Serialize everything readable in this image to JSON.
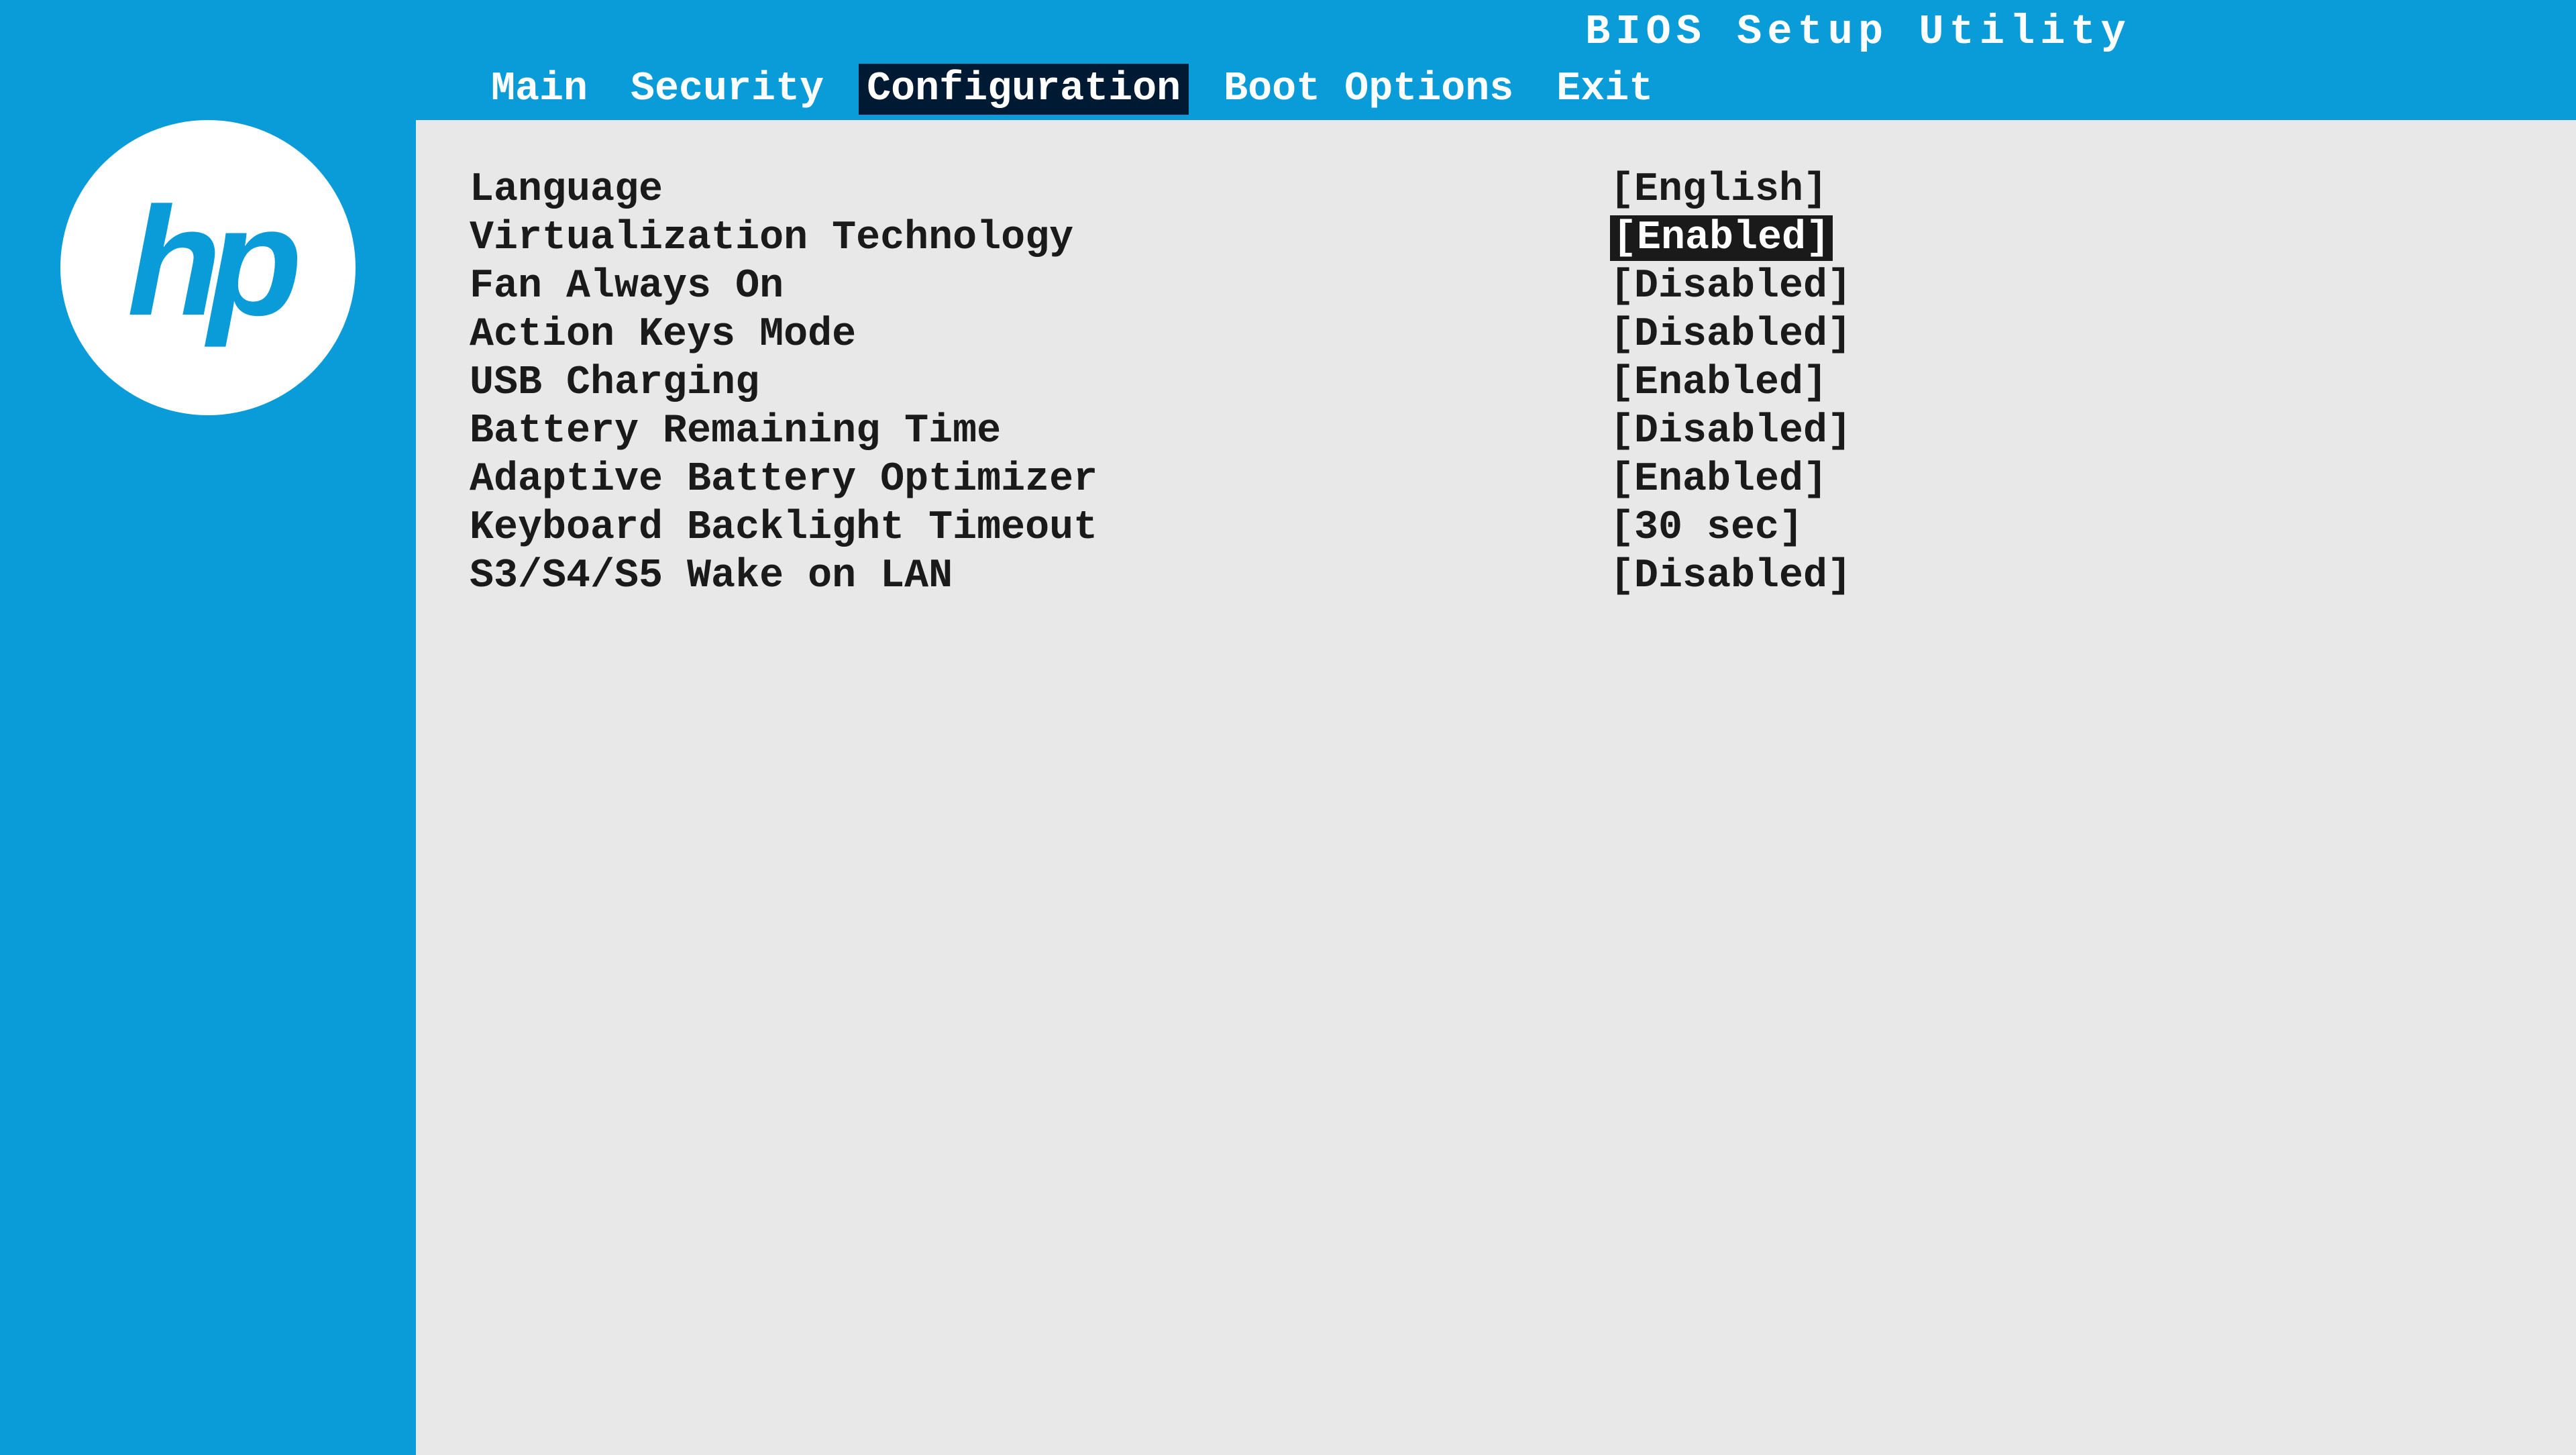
{
  "header": {
    "title": "BIOS Setup Utility",
    "tabs": [
      {
        "label": "Main",
        "active": false
      },
      {
        "label": "Security",
        "active": false
      },
      {
        "label": "Configuration",
        "active": true
      },
      {
        "label": "Boot Options",
        "active": false
      },
      {
        "label": "Exit",
        "active": false
      }
    ]
  },
  "logo": "hp",
  "settings": [
    {
      "label": "Language",
      "value": "[English]",
      "selected": false
    },
    {
      "label": "Virtualization Technology",
      "value": "[Enabled]",
      "selected": true
    },
    {
      "label": "Fan Always On",
      "value": "[Disabled]",
      "selected": false
    },
    {
      "label": "Action Keys Mode",
      "value": "[Disabled]",
      "selected": false
    },
    {
      "label": "USB Charging",
      "value": "[Enabled]",
      "selected": false
    },
    {
      "label": "Battery Remaining Time",
      "value": "[Disabled]",
      "selected": false
    },
    {
      "label": "Adaptive Battery Optimizer",
      "value": "[Enabled]",
      "selected": false
    },
    {
      "label": "Keyboard Backlight Timeout",
      "value": "[30 sec]",
      "selected": false
    },
    {
      "label": "S3/S4/S5 Wake on LAN",
      "value": "[Disabled]",
      "selected": false
    }
  ]
}
